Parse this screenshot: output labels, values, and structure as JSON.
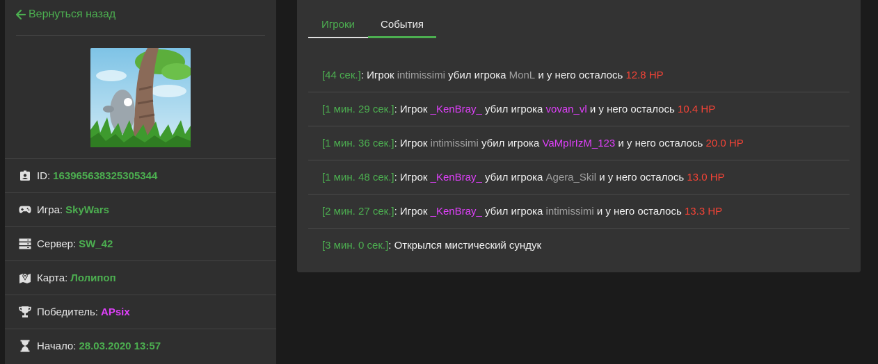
{
  "back": {
    "label": "Вернуться назад",
    "icon": "arrow-left-icon",
    "color": "#4caf50"
  },
  "game_image": {
    "icon": "cartoon-tree-scene"
  },
  "info": [
    {
      "icon": "id-badge-icon",
      "label": "ID:",
      "value": "163965638325305344",
      "style": "green"
    },
    {
      "icon": "gamepad-icon",
      "label": "Игра:",
      "value": "SkyWars",
      "style": "green"
    },
    {
      "icon": "server-icon",
      "label": "Сервер:",
      "value": "SW_42",
      "style": "green"
    },
    {
      "icon": "map-icon",
      "label": "Карта:",
      "value": "Лолипоп",
      "style": "green"
    },
    {
      "icon": "trophy-icon",
      "label": "Победитель:",
      "value": "APsix",
      "style": "pink"
    },
    {
      "icon": "hourglass-icon",
      "label": "Начало:",
      "value": "28.03.2020 13:57",
      "style": "green"
    }
  ],
  "tabs": [
    {
      "label": "Игроки"
    },
    {
      "label": "События",
      "active": true
    }
  ],
  "events": [
    {
      "time": "[44 сек.]",
      "sep": ": Игрок ",
      "killer": "intimissimi",
      "killer_style": "gray",
      "mid": " убил игрока ",
      "victim": "MonL",
      "victim_style": "gray",
      "tail": " и у него осталось ",
      "hp": "12.8 HP"
    },
    {
      "time": "[1 мин. 29 сек.]",
      "sep": ": Игрок ",
      "killer": "_KenBray_",
      "killer_style": "pink",
      "mid": " убил игрока ",
      "victim": "vovan_vl",
      "victim_style": "pink",
      "tail": " и у него осталось ",
      "hp": "10.4 HP"
    },
    {
      "time": "[1 мин. 36 сек.]",
      "sep": ": Игрок ",
      "killer": "intimissimi",
      "killer_style": "gray",
      "mid": " убил игрока ",
      "victim": "VaMpIrIzM_123",
      "victim_style": "pink",
      "tail": " и у него осталось ",
      "hp": "20.0 HP"
    },
    {
      "time": "[1 мин. 48 сек.]",
      "sep": ": Игрок ",
      "killer": "_KenBray_",
      "killer_style": "pink",
      "mid": " убил игрока ",
      "victim": "Agera_Skil",
      "victim_style": "gray",
      "tail": " и у него осталось ",
      "hp": "13.0 HP"
    },
    {
      "time": "[2 мин. 27 сек.]",
      "sep": ": Игрок ",
      "killer": "_KenBray_",
      "killer_style": "pink",
      "mid": " убил игрока ",
      "victim": "intimissimi",
      "victim_style": "gray",
      "tail": " и у него осталось ",
      "hp": "13.3 HP"
    },
    {
      "time": "[3 мин. 0 сек.]",
      "text": ": Открылся мистический сундук"
    }
  ],
  "colors": {
    "green": "#4caf50",
    "pink": "#e040fb",
    "hp": "#f44336",
    "gray": "#a0a0a0"
  }
}
